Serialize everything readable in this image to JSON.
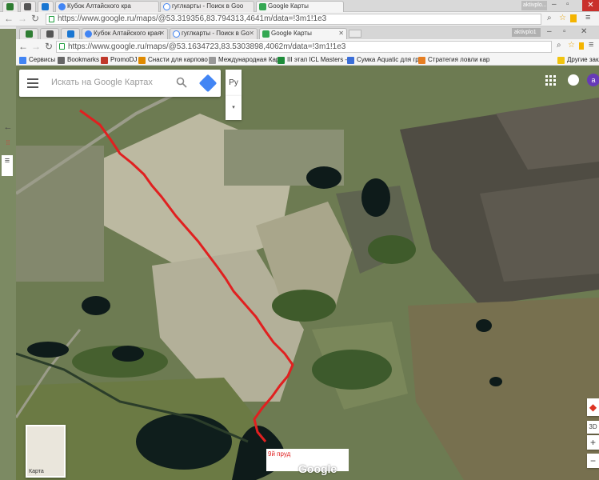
{
  "outer_browser": {
    "tabs": [
      {
        "label": ""
      },
      {
        "label": ""
      },
      {
        "label": "Кубок Алтайского кра"
      },
      {
        "label": "гуглкарты - Поиск в Goo"
      },
      {
        "label": "Google Карты"
      }
    ],
    "url": "https://www.google.ru/maps/@53.319356,83.794313,4641m/data=!3m1!1e3",
    "right_badge": "aktivplo..."
  },
  "inner_browser": {
    "tabs": [
      {
        "label": "Кубок Алтайского края"
      },
      {
        "label": "гуглкарты - Поиск в Go"
      },
      {
        "label": "Google Карты"
      }
    ],
    "right_badge": "aktivplo1",
    "url": "https://www.google.ru/maps/@53.1634723,83.5303898,4062m/data=!3m1!1e3",
    "bookmarks": [
      {
        "label": "Сервисы",
        "color": "#4285f4"
      },
      {
        "label": "Bookmarks",
        "color": "#666666"
      },
      {
        "label": "PromoDJ",
        "color": "#c0392b"
      },
      {
        "label": "Снасти для карпово",
        "color": "#e08a00"
      },
      {
        "label": "Международная Кар",
        "color": "#999999"
      },
      {
        "label": "III этап ICL Masters -",
        "color": "#1e8c3a"
      },
      {
        "label": "Сумка Aquatic для гр",
        "color": "#3b6ed8"
      },
      {
        "label": "Стратегия ловли кар",
        "color": "#e67e22"
      },
      {
        "label": "Другие закл",
        "color": "#f1c40f"
      }
    ]
  },
  "map": {
    "search_placeholder": "Искать на Google Картах",
    "lang_button": "Ру",
    "thumb_label": "Карта",
    "google_logo": "Google",
    "marker_label": "9й пруд",
    "avatar_letter": "a",
    "controls": [
      "3D",
      "+",
      "−"
    ]
  },
  "colors": {
    "route": "#e02020",
    "field_light": "#b7b39a",
    "field_dark": "#6c7b4e",
    "water": "#0d1a1a"
  }
}
